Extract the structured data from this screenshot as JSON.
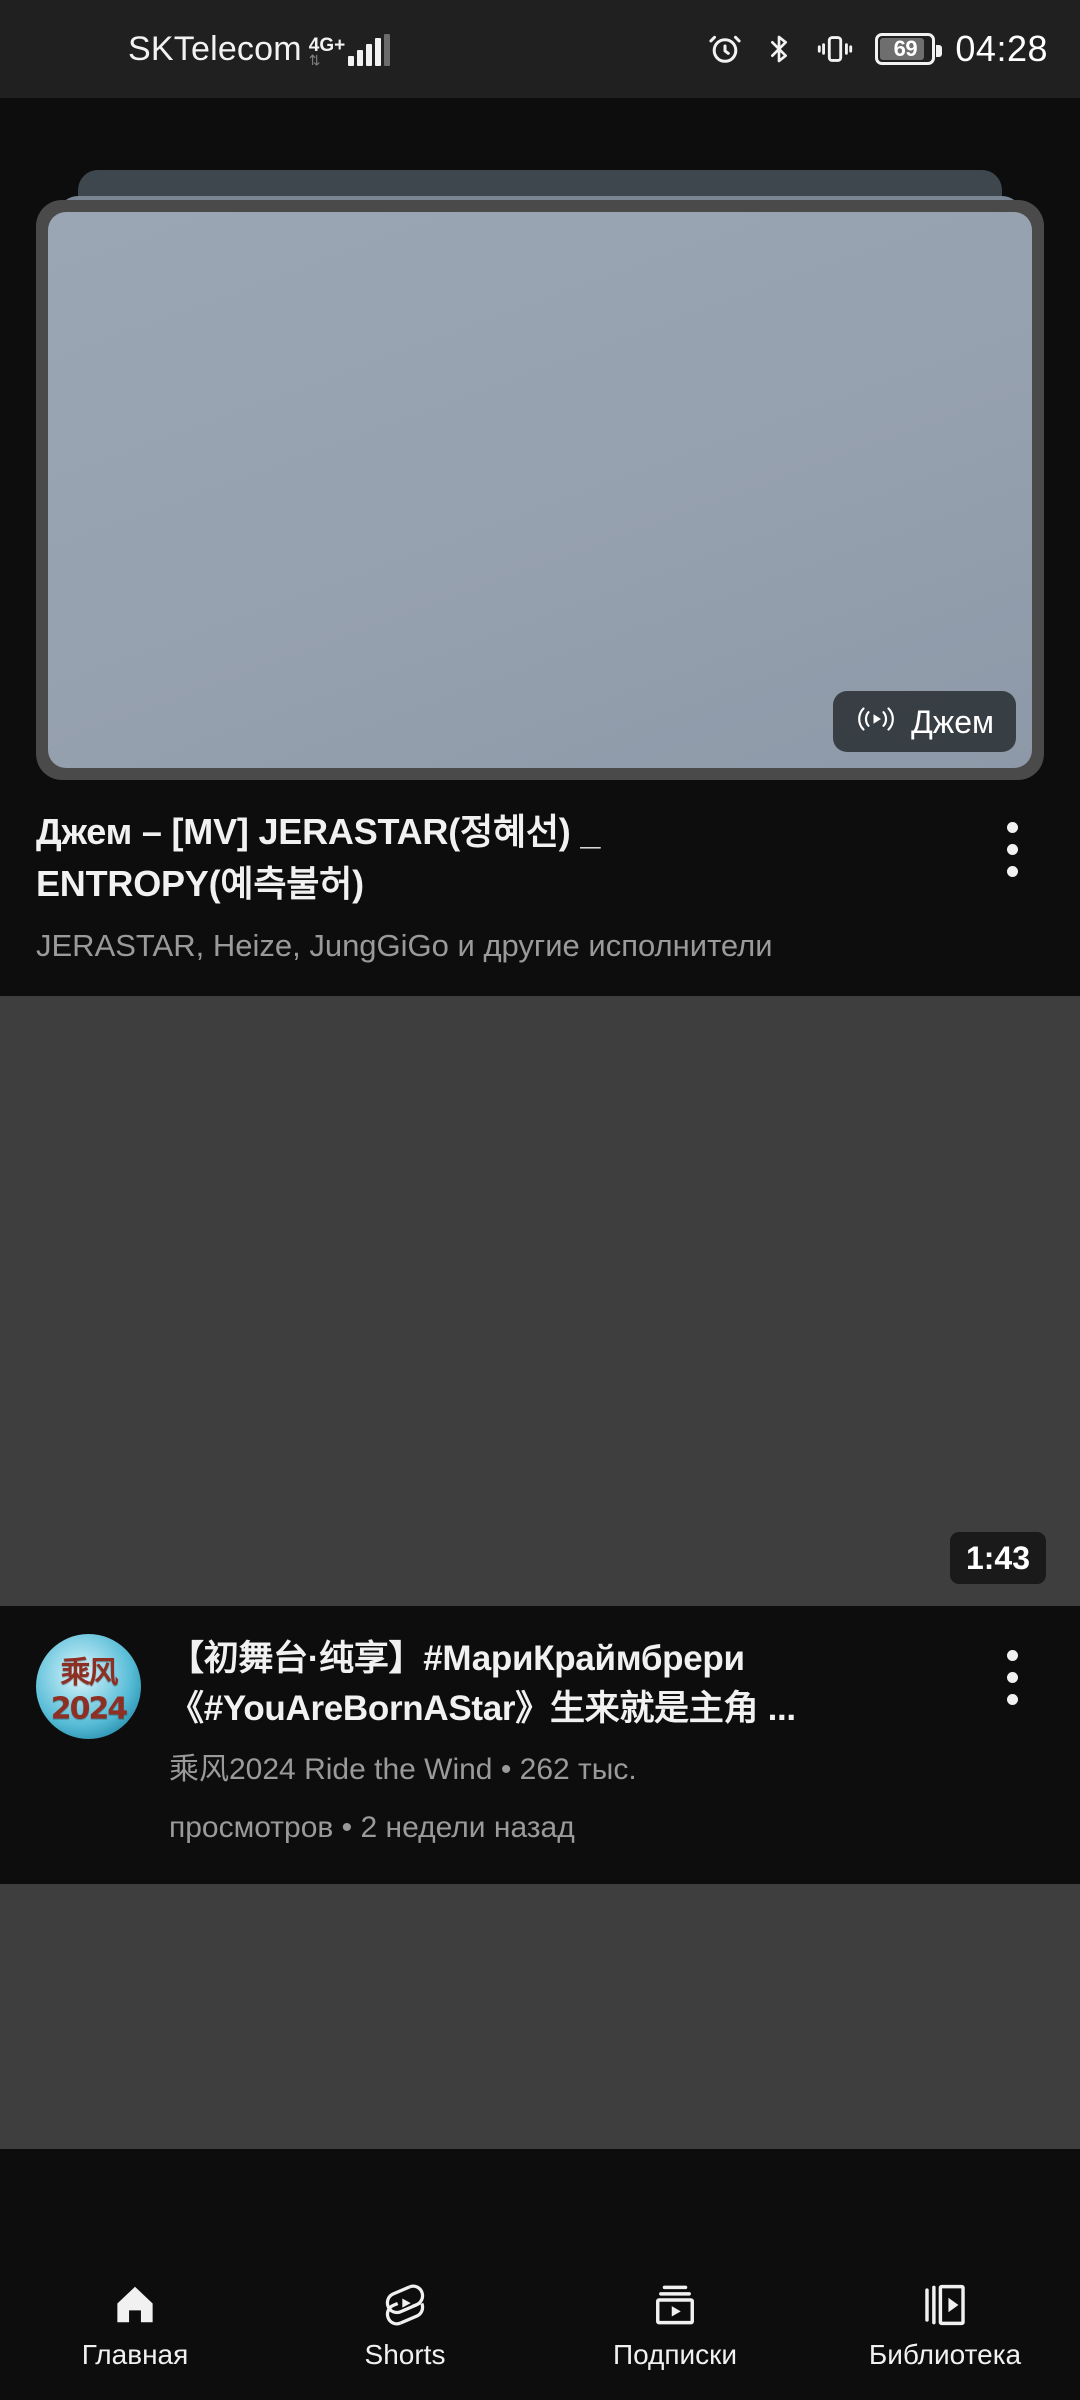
{
  "status_bar": {
    "carrier": "SKTelecom",
    "network_type": "4G+",
    "signal_icon": "signal-bars-icon",
    "alarm_icon": "alarm-clock-icon",
    "bluetooth_icon": "bluetooth-icon",
    "vibrate_icon": "vibrate-icon",
    "battery_level": "69",
    "battery_icon": "battery-icon",
    "time": "04:28"
  },
  "feed": {
    "featured": {
      "thumbnail_placeholder": "video-thumbnail-placeholder",
      "cast_badge": {
        "icon": "broadcast-play-icon",
        "label": "Джем"
      },
      "title_line_1": "Джем – [MV] JERASTAR(정혜선) _",
      "title_line_2": "ENTROPY(예측불허)",
      "subtitle": "JERASTAR, Heize, JungGiGo и другие исполнители",
      "menu_icon": "kebab-menu-icon"
    },
    "video_item": {
      "duration": "1:43",
      "avatar_glyph": "乘风2024",
      "title_line_1": "【初舞台·纯享】#МариКраймбрери",
      "title_line_2": "《#YouAreBornAStar》生来就是主角 ...",
      "meta_line_1": "乘风2024 Ride the Wind  • 262 тыс.",
      "meta_line_2": "просмотров • 2 недели назад",
      "menu_icon": "kebab-menu-icon"
    }
  },
  "bottom_nav": {
    "items": [
      {
        "label": "Главная",
        "icon": "home-icon",
        "active": true
      },
      {
        "label": "Shorts",
        "icon": "shorts-icon",
        "active": false
      },
      {
        "label": "Подписки",
        "icon": "subscriptions-icon",
        "active": false
      },
      {
        "label": "Библиотека",
        "icon": "library-icon",
        "active": false
      }
    ]
  },
  "colors": {
    "background": "#0d0d0d",
    "statusbar_bg": "#202020",
    "placeholder_gray": "#3e3e3e",
    "thumbnail_gray_blue": "#9aa6b4",
    "text_primary": "#f1f1f1",
    "text_secondary": "#9a9a9a"
  }
}
